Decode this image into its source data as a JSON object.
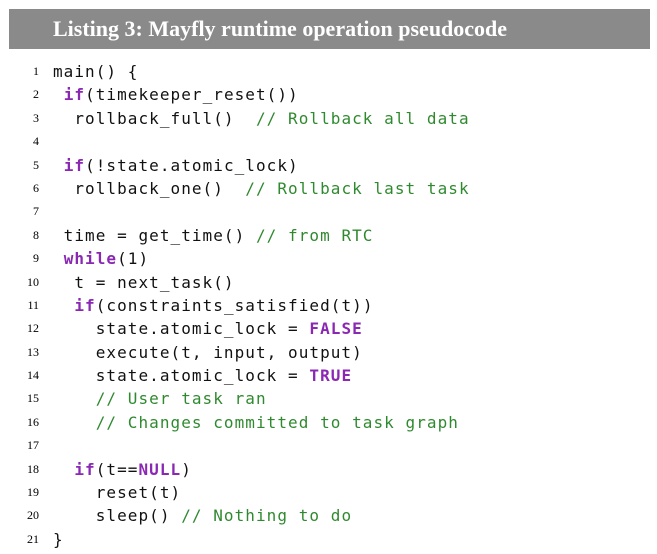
{
  "listing": {
    "title": "Listing 3: Mayfly runtime operation pseudocode"
  },
  "code": [
    {
      "n": "1",
      "tokens": [
        {
          "t": "main() {",
          "k": "plain"
        }
      ]
    },
    {
      "n": "2",
      "tokens": [
        {
          "t": " ",
          "k": "plain"
        },
        {
          "t": "if",
          "k": "keyword"
        },
        {
          "t": "(timekeeper_reset())",
          "k": "plain"
        }
      ]
    },
    {
      "n": "3",
      "tokens": [
        {
          "t": "  rollback_full()  ",
          "k": "plain"
        },
        {
          "t": "// Rollback all data",
          "k": "comment"
        }
      ]
    },
    {
      "n": "4",
      "tokens": []
    },
    {
      "n": "5",
      "tokens": [
        {
          "t": " ",
          "k": "plain"
        },
        {
          "t": "if",
          "k": "keyword"
        },
        {
          "t": "(!state.atomic_lock)",
          "k": "plain"
        }
      ]
    },
    {
      "n": "6",
      "tokens": [
        {
          "t": "  rollback_one()  ",
          "k": "plain"
        },
        {
          "t": "// Rollback last task",
          "k": "comment"
        }
      ]
    },
    {
      "n": "7",
      "tokens": []
    },
    {
      "n": "8",
      "tokens": [
        {
          "t": " time = get_time() ",
          "k": "plain"
        },
        {
          "t": "// from RTC",
          "k": "comment"
        }
      ]
    },
    {
      "n": "9",
      "tokens": [
        {
          "t": " ",
          "k": "plain"
        },
        {
          "t": "while",
          "k": "keyword"
        },
        {
          "t": "(1)",
          "k": "plain"
        }
      ]
    },
    {
      "n": "10",
      "tokens": [
        {
          "t": "  t = next_task()",
          "k": "plain"
        }
      ]
    },
    {
      "n": "11",
      "tokens": [
        {
          "t": "  ",
          "k": "plain"
        },
        {
          "t": "if",
          "k": "keyword"
        },
        {
          "t": "(constraints_satisfied(t))",
          "k": "plain"
        }
      ]
    },
    {
      "n": "12",
      "tokens": [
        {
          "t": "    state.atomic_lock = ",
          "k": "plain"
        },
        {
          "t": "FALSE",
          "k": "keyword"
        }
      ]
    },
    {
      "n": "13",
      "tokens": [
        {
          "t": "    execute(t, input, output)",
          "k": "plain"
        }
      ]
    },
    {
      "n": "14",
      "tokens": [
        {
          "t": "    state.atomic_lock = ",
          "k": "plain"
        },
        {
          "t": "TRUE",
          "k": "keyword"
        }
      ]
    },
    {
      "n": "15",
      "tokens": [
        {
          "t": "    ",
          "k": "plain"
        },
        {
          "t": "// User task ran",
          "k": "comment"
        }
      ]
    },
    {
      "n": "16",
      "tokens": [
        {
          "t": "    ",
          "k": "plain"
        },
        {
          "t": "// Changes committed to task graph",
          "k": "comment"
        }
      ]
    },
    {
      "n": "17",
      "tokens": []
    },
    {
      "n": "18",
      "tokens": [
        {
          "t": "  ",
          "k": "plain"
        },
        {
          "t": "if",
          "k": "keyword"
        },
        {
          "t": "(t==",
          "k": "plain"
        },
        {
          "t": "NULL",
          "k": "keyword"
        },
        {
          "t": ")",
          "k": "plain"
        }
      ]
    },
    {
      "n": "19",
      "tokens": [
        {
          "t": "    reset(t)",
          "k": "plain"
        }
      ]
    },
    {
      "n": "20",
      "tokens": [
        {
          "t": "    sleep() ",
          "k": "plain"
        },
        {
          "t": "// Nothing to do",
          "k": "comment"
        }
      ]
    },
    {
      "n": "21",
      "tokens": [
        {
          "t": "}",
          "k": "plain"
        }
      ]
    }
  ],
  "colors": {
    "header_bg": "#8a8a8a",
    "header_text": "#ffffff",
    "keyword": "#8a27b3",
    "comment": "#2f8a2f",
    "code_text": "#111111"
  }
}
